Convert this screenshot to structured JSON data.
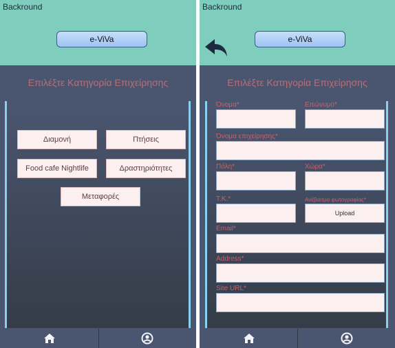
{
  "left_screen": {
    "caption": "Backround",
    "logo_label": "e-ViVa",
    "category_title": "Επιλέξτε Κατηγορία Επιχείρησης",
    "categories": [
      "Διαμονή",
      "Πτήσεις",
      "Food cafe Nightlife",
      "Δραστηριότητες",
      "Μεταφορές"
    ],
    "nav": {
      "home_icon": "home-icon",
      "profile_icon": "user-icon"
    }
  },
  "right_screen": {
    "caption": "Backround",
    "logo_label": "e-ViVa",
    "category_title": "Επιλέξτε Κατηγορία Επιχείρησης",
    "back_icon": "back-arrow-icon",
    "form": {
      "first_name_label": "Όνομα*",
      "last_name_label": "Επώνυμο*",
      "business_name_label": "Όνομα επιχείρησης*",
      "city_label": "Πόλη*",
      "country_label": "Χώρα*",
      "postal_code_label": "Τ.Κ.*",
      "photo_label": "Ανέβασμα φωτογραφίας*",
      "upload_label": "Upload",
      "email_label": "Email*",
      "address_label": "Address*",
      "site_url_label": "Site URL*"
    },
    "nav": {
      "home_icon": "home-icon",
      "profile_icon": "user-icon"
    }
  },
  "colors": {
    "top_bar": "#7ecdbd",
    "dark_bg": "#4a5670",
    "accent_text": "#c1646f",
    "panel_border": "#86d2f0",
    "button_fill": "#fcefef"
  }
}
